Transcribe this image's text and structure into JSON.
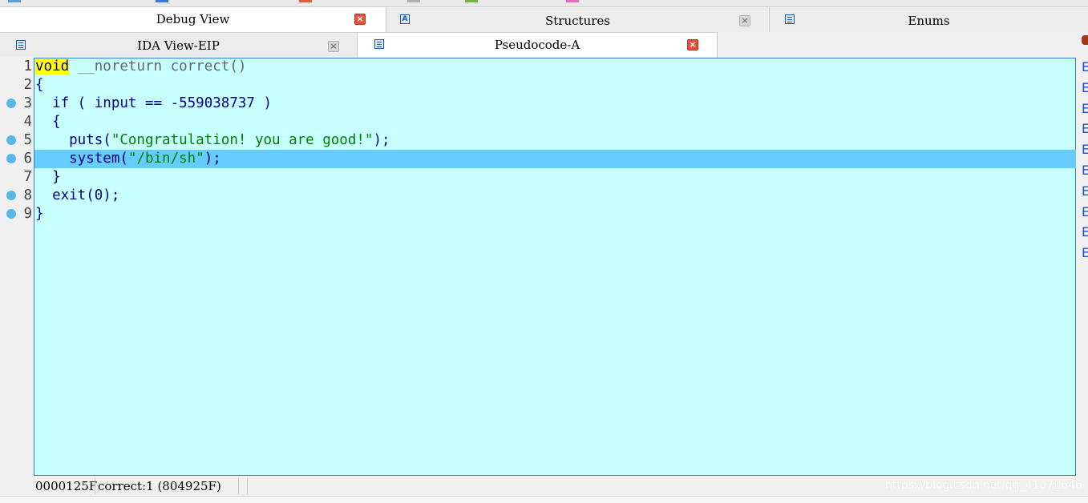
{
  "tabs_top": [
    {
      "label": "Debug View",
      "active": true
    },
    {
      "label": "Structures",
      "active": false,
      "icon_letter": "A"
    },
    {
      "label": "Enums",
      "active": false
    }
  ],
  "tabs_second": [
    {
      "label": "IDA View-EIP",
      "active": false
    },
    {
      "label": "Pseudocode-A",
      "active": true
    }
  ],
  "close_glyph": "×",
  "code": [
    {
      "num": "1",
      "bp": false,
      "hl": false,
      "tokens": [
        {
          "t": "void",
          "c": "kw-void"
        },
        {
          "t": " __noreturn correct()",
          "c": "gray"
        }
      ]
    },
    {
      "num": "2",
      "bp": false,
      "hl": false,
      "tokens": [
        {
          "t": "{",
          "c": "navy"
        }
      ]
    },
    {
      "num": "3",
      "bp": true,
      "hl": false,
      "tokens": [
        {
          "t": "  if ( input == -559038737 )",
          "c": "navy"
        }
      ]
    },
    {
      "num": "4",
      "bp": false,
      "hl": false,
      "tokens": [
        {
          "t": "  {",
          "c": "navy"
        }
      ]
    },
    {
      "num": "5",
      "bp": true,
      "hl": false,
      "tokens": [
        {
          "t": "    puts(",
          "c": "navy"
        },
        {
          "t": "\"Congratulation! you are good!\"",
          "c": "green"
        },
        {
          "t": ");",
          "c": "navy"
        }
      ]
    },
    {
      "num": "6",
      "bp": true,
      "hl": true,
      "tokens": [
        {
          "t": "    system(",
          "c": "navy"
        },
        {
          "t": "\"/bin/sh\"",
          "c": "green"
        },
        {
          "t": ");",
          "c": "navy"
        }
      ]
    },
    {
      "num": "7",
      "bp": false,
      "hl": false,
      "tokens": [
        {
          "t": "  }",
          "c": "navy"
        }
      ]
    },
    {
      "num": "8",
      "bp": true,
      "hl": false,
      "tokens": [
        {
          "t": "  exit(0);",
          "c": "navy"
        }
      ]
    },
    {
      "num": "9",
      "bp": true,
      "hl": false,
      "tokens": [
        {
          "t": "}",
          "c": "navy"
        }
      ]
    }
  ],
  "status": {
    "address": "0000125F",
    "location": "correct:1 (804925F)"
  },
  "watermark": "https://blog.csdn.net/qq_41071646",
  "right_glyphs": [
    "E",
    "E",
    "E",
    "E",
    "E",
    "E",
    "E",
    "E",
    "E",
    "E"
  ],
  "colors": {
    "editor_bg": "#c8ffff",
    "highlight": "#66ccff",
    "keyword_highlight": "#ffff00",
    "string": "#008000",
    "code": "#00008b"
  }
}
